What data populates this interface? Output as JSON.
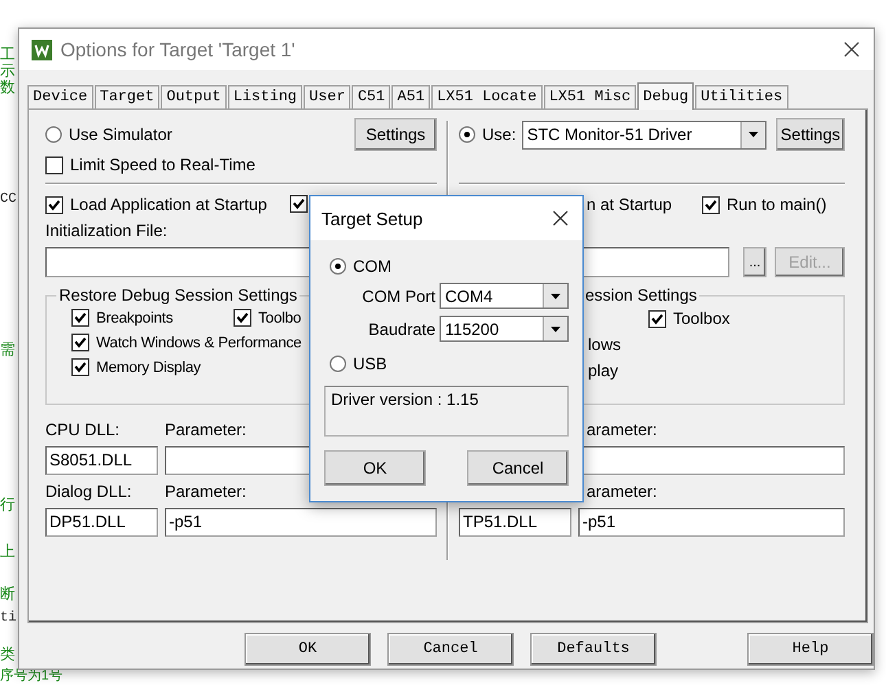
{
  "background_text": [
    {
      "text": "工",
      "kind": "comment"
    },
    {
      "text": "示",
      "kind": "comment"
    },
    {
      "text": "数",
      "kind": "comment"
    },
    {
      "text": "CC",
      "kind": "code"
    },
    {
      "text": "需",
      "kind": "comment"
    },
    {
      "text": "行",
      "kind": "comment"
    },
    {
      "text": "上",
      "kind": "comment"
    },
    {
      "text": "断",
      "kind": "comment"
    },
    {
      "text": "ti",
      "kind": "code"
    },
    {
      "text": "类",
      "kind": "comment"
    },
    {
      "text": "序号为1号",
      "kind": "comment"
    }
  ],
  "window": {
    "title": "Options for Target 'Target 1'"
  },
  "tabs": [
    {
      "label": "Device",
      "selected": false
    },
    {
      "label": "Target",
      "selected": false
    },
    {
      "label": "Output",
      "selected": false
    },
    {
      "label": "Listing",
      "selected": false
    },
    {
      "label": "User",
      "selected": false
    },
    {
      "label": "C51",
      "selected": false
    },
    {
      "label": "A51",
      "selected": false
    },
    {
      "label": "LX51 Locate",
      "selected": false
    },
    {
      "label": "LX51 Misc",
      "selected": false
    },
    {
      "label": "Debug",
      "selected": true
    },
    {
      "label": "Utilities",
      "selected": false
    }
  ],
  "debug_left": {
    "source": {
      "label": "Use Simulator",
      "selected": false
    },
    "settings_button": "Settings",
    "limit_speed": {
      "label": "Limit Speed to Real-Time",
      "checked": false
    },
    "load_application": {
      "label": "Load Application at Startup",
      "checked": true
    },
    "second_option": {
      "checked": true
    },
    "init_file_label": "Initialization File:",
    "restore": {
      "title": "Restore Debug Session Settings",
      "options": [
        {
          "label": "Breakpoints",
          "checked": true
        },
        {
          "label": "Toolbo",
          "checked": true
        },
        {
          "label": "Watch Windows & Performance",
          "checked": true
        },
        {
          "label": "Memory Display",
          "checked": true
        }
      ]
    },
    "cpu_dll_label": "CPU DLL:",
    "cpu_parameter_label": "Parameter:",
    "cpu_dll": "S8051.DLL",
    "dialog_dll_label": "Dialog DLL:",
    "dialog_parameter_label": "Parameter:",
    "dialog_dll": "DP51.DLL",
    "dialog_parameter": "-p51"
  },
  "debug_right": {
    "source": {
      "label": "Use:",
      "selected": true
    },
    "driver": "STC Monitor-51 Driver",
    "settings_button": "Settings",
    "load_application_rest": "n at Startup",
    "run_to_main": {
      "label": "Run to main()",
      "checked": true
    },
    "browse_button": "...",
    "edit_button": {
      "label": "Edit...",
      "disabled": true
    },
    "restore": {
      "title": "ession Settings",
      "toolbox": {
        "label": "Toolbox",
        "checked": true
      },
      "continued": [
        "lows",
        "play"
      ]
    },
    "cpu_parameter_label": "arameter:",
    "dialog_parameter_label": "arameter:",
    "dialog_dll": "TP51.DLL",
    "dialog_parameter": "-p51"
  },
  "target_setup": {
    "title": "Target Setup",
    "interfaces": [
      {
        "label": "COM",
        "selected": true
      },
      {
        "label": "USB",
        "selected": false
      }
    ],
    "com_port_label": "COM Port",
    "com_port": "COM4",
    "baudrate_label": "Baudrate",
    "baudrate": "115200",
    "driver_version": "Driver version : 1.15",
    "buttons": [
      "OK",
      "Cancel"
    ]
  },
  "buttons": [
    "OK",
    "Cancel",
    "Defaults",
    "Help"
  ]
}
